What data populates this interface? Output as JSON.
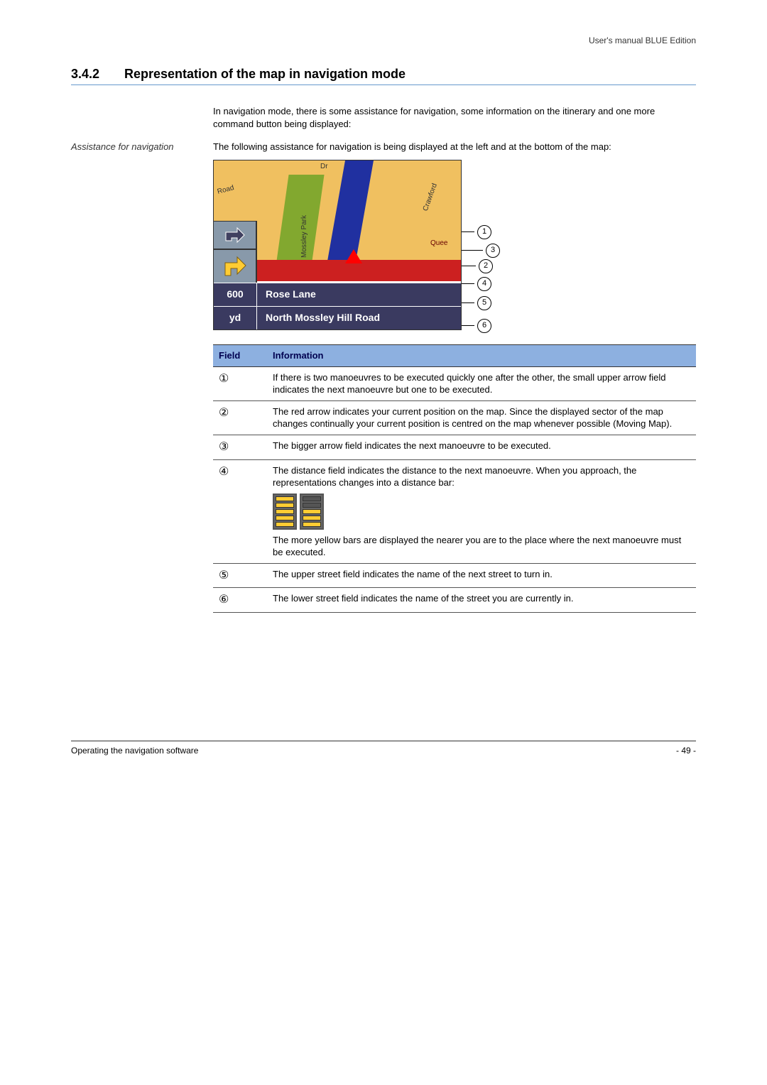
{
  "header": {
    "right": "User's manual BLUE Edition"
  },
  "section": {
    "number": "3.4.2",
    "title": "Representation of the map in navigation mode"
  },
  "intro": "In navigation mode, there is some assistance for navigation, some information on the itinerary and one more command button being displayed:",
  "margin_note": "Assistance for navigation",
  "assistance_para": "The following assistance for navigation is being displayed at the left and at the bottom of the map:",
  "map": {
    "labels": {
      "road_nw": "Road",
      "park": "Mossley Park",
      "crawford": "Crawford",
      "drive": "Dr",
      "queens": "Quee"
    },
    "panel": {
      "distance_value": "600",
      "distance_unit": "yd",
      "street_upper": "Rose Lane",
      "street_lower": "North Mossley Hill Road"
    },
    "callouts": [
      "1",
      "2",
      "3",
      "4",
      "5",
      "6"
    ]
  },
  "table": {
    "headers": {
      "field": "Field",
      "info": "Information"
    },
    "rows": [
      {
        "field": "①",
        "info": "If there is two manoeuvres to be executed quickly one after the other, the small upper arrow field indicates the next manoeuvre but one to be executed."
      },
      {
        "field": "②",
        "info": "The red arrow indicates your current position on the map. Since the displayed sector of the map changes continually your current position is centred on the map whenever possible (Moving Map)."
      },
      {
        "field": "③",
        "info": "The bigger arrow field indicates the next manoeuvre to be executed."
      },
      {
        "field": "④",
        "info_a": "The distance field indicates the distance to the next manoeuvre. When you approach, the representations changes into a distance bar:",
        "info_b": "The more yellow bars are displayed the nearer you are to the place where the next manoeuvre must be executed."
      },
      {
        "field": "⑤",
        "info": "The upper street field indicates the name of the next street to turn in."
      },
      {
        "field": "⑥",
        "info": "The lower street field indicates the name of the street you are currently in."
      }
    ]
  },
  "footer": {
    "left": "Operating the navigation software",
    "right": "- 49 -"
  }
}
